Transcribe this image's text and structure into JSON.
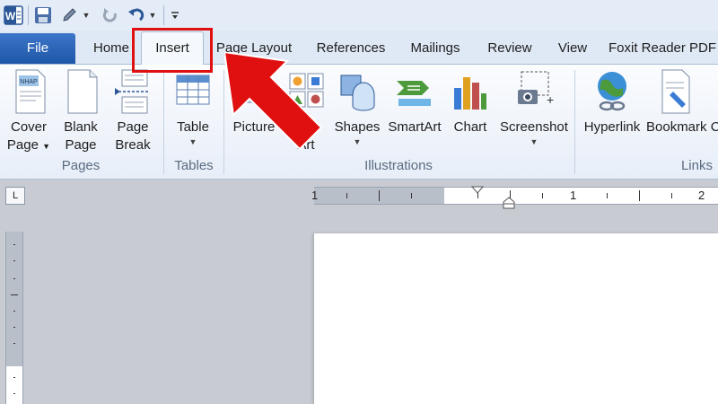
{
  "quick_access": {
    "app_icon": "word-app-icon",
    "items": [
      "save-icon",
      "pen-icon",
      "redo-icon",
      "undo-icon",
      "customize-icon"
    ]
  },
  "tabs": {
    "file": "File",
    "home": "Home",
    "insert": "Insert",
    "page_layout": "Page Layout",
    "references": "References",
    "mailings": "Mailings",
    "review": "Review",
    "view": "View",
    "foxit": "Foxit Reader PDF"
  },
  "ribbon": {
    "pages": {
      "label": "Pages",
      "cover_page": [
        "Cover",
        "Page"
      ],
      "blank_page": [
        "Blank",
        "Page"
      ],
      "page_break": [
        "Page",
        "Break"
      ]
    },
    "tables": {
      "label": "Tables",
      "table": "Table"
    },
    "illustrations": {
      "label": "Illustrations",
      "picture": "Picture",
      "clip_art": "Art",
      "clip_art_top": "p",
      "shapes": "Shapes",
      "smartart": "SmartArt",
      "chart": "Chart",
      "screenshot": "Screenshot"
    },
    "links": {
      "label": "Links",
      "hyperlink": "Hyperlink",
      "bookmark": "Bookmark C"
    }
  },
  "ruler": {
    "tab_selector": "L",
    "left_number": "1",
    "numbers": [
      "1",
      "2"
    ]
  },
  "colors": {
    "highlight": "#e01010",
    "file_tab": "#2a62b3",
    "tab_bar": "#dfe9f5"
  }
}
